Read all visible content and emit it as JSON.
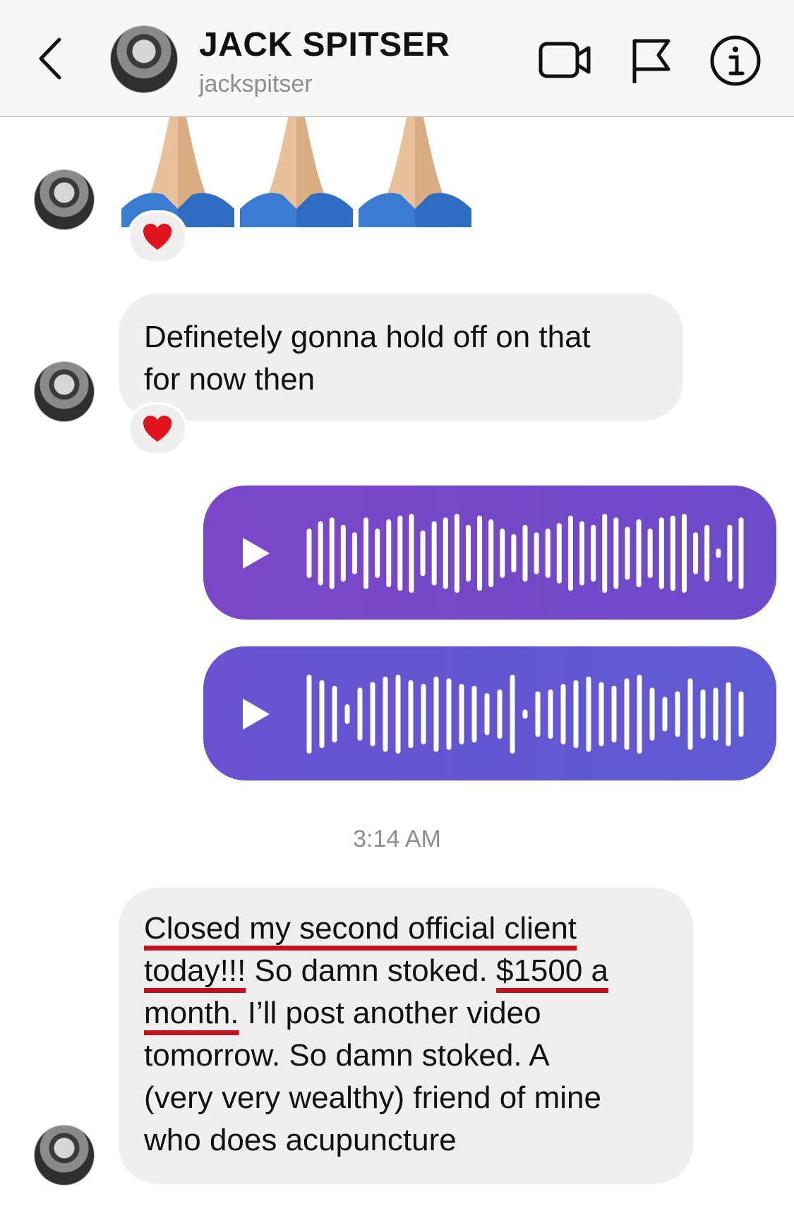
{
  "header": {
    "name": "JACK SPITSER",
    "username": "jackspitser",
    "icons": [
      "back-chevron-icon",
      "video-camera-icon",
      "flag-icon",
      "info-icon"
    ]
  },
  "messages": {
    "emoji_message": {
      "emoji": "🙏🙏🙏",
      "reaction": "❤️"
    },
    "text_1": {
      "text": "Definetely gonna hold off on that for now then",
      "line1": "Definetely gonna hold off on that",
      "line2": "for now then",
      "reaction": "❤️"
    },
    "voice_1": {
      "icon": "play-icon",
      "color": "#6E4BC9"
    },
    "voice_2": {
      "icon": "play-icon",
      "color": "#5F5AD3"
    },
    "timestamp": "3:14 AM",
    "text_2": {
      "parts": {
        "a": "Closed my second official client",
        "b": "today!!!",
        "c": " So damn stoked. ",
        "d": "$1500 a",
        "e": "month.",
        "f": " I’ll post another video",
        "g": "tomorrow. So damn stoked. A",
        "h": "(very very wealthy) friend of mine",
        "i": "who does acupuncture"
      },
      "highlight_color": "#C3121F"
    }
  },
  "colors": {
    "header_bg": "#F7F7F7",
    "bubble_in": "#EFEFEF",
    "muted_text": "#8E8E8E"
  }
}
